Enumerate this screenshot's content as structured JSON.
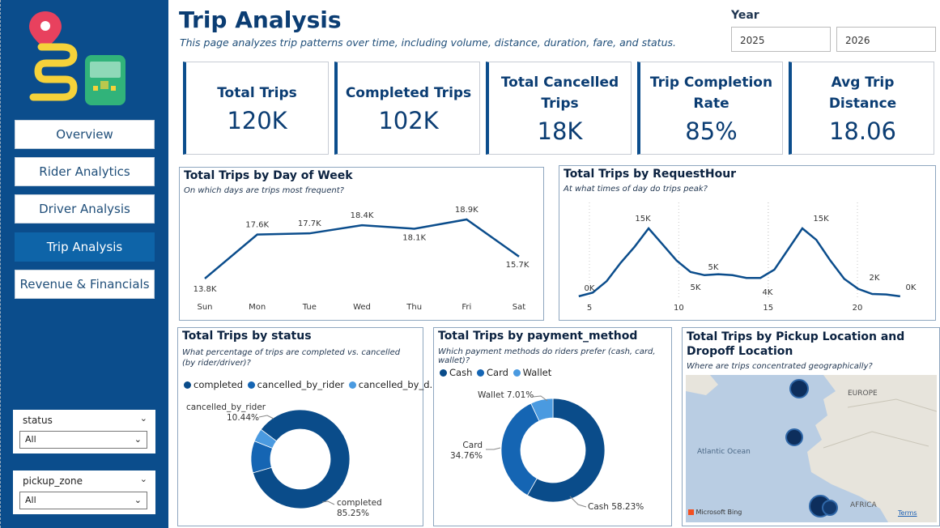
{
  "nav": {
    "items": [
      "Overview",
      "Rider Analytics",
      "Driver Analysis",
      "Trip Analysis",
      "Revenue & Financials"
    ],
    "active_index": 3
  },
  "filters": {
    "status": {
      "label": "status",
      "value": "All"
    },
    "pickup_zone": {
      "label": "pickup_zone",
      "value": "All"
    }
  },
  "header": {
    "title": "Trip Analysis",
    "subtitle": "This page analyzes trip patterns over time, including volume, distance, duration, fare, and status.",
    "year_label": "Year",
    "years": [
      "2025",
      "2026"
    ]
  },
  "kpis": [
    {
      "title": "Total Trips",
      "value": "120K"
    },
    {
      "title": "Completed Trips",
      "value": "102K"
    },
    {
      "title": "Total Cancelled Trips",
      "value": "18K"
    },
    {
      "title": "Trip Completion Rate",
      "value": "85%"
    },
    {
      "title": "Avg Trip Distance",
      "value": "18.06"
    }
  ],
  "colors": {
    "brand": "#0b4d8c",
    "line": "#0b4d8c",
    "completed": "#0a4c8a",
    "cancelled_by_rider": "#1565b3",
    "cancelled_by_driver": "#4a9ae0",
    "cash": "#0a4c8a",
    "card": "#1565b3",
    "wallet": "#4a9ae0"
  },
  "day_chart": {
    "title": "Total Trips by Day of Week",
    "subtitle": "On which days are trips most frequent?"
  },
  "hour_chart": {
    "title": "Total Trips by RequestHour",
    "subtitle": "At what times of day do trips peak?"
  },
  "status_chart": {
    "title": "Total Trips by status",
    "subtitle": "What percentage of trips are completed vs. cancelled (by rider/driver)?",
    "legend": [
      "completed",
      "cancelled_by_rider",
      "cancelled_by_d..."
    ],
    "label_rider_name": "cancelled_by_rider",
    "label_rider_pct": "10.44%",
    "label_completed_name": "completed",
    "label_completed_pct": "85.25%"
  },
  "payment_chart": {
    "title": "Total Trips by payment_method",
    "subtitle": "Which payment methods do riders prefer (cash, card, wallet)?",
    "legend": [
      "Cash",
      "Card",
      "Wallet"
    ],
    "label_wallet": "Wallet 7.01%",
    "label_card_name": "Card",
    "label_card_pct": "34.76%",
    "label_cash": "Cash 58.23%"
  },
  "map": {
    "title": "Total Trips by Pickup Location and Dropoff Location",
    "subtitle": "Where are trips concentrated geographically?",
    "label_europe": "EUROPE",
    "label_ocean": "Atlantic Ocean",
    "label_africa": "AFRICA",
    "bing": "Microsoft Bing",
    "terms": "Terms"
  },
  "chart_data": [
    {
      "type": "line",
      "title": "Total Trips by Day of Week",
      "categories": [
        "Sun",
        "Mon",
        "Tue",
        "Wed",
        "Thu",
        "Fri",
        "Sat"
      ],
      "values": [
        13.8,
        17.6,
        17.7,
        18.4,
        18.1,
        18.9,
        15.7
      ],
      "data_labels": [
        "13.8K",
        "17.6K",
        "17.7K",
        "18.4K",
        "18.1K",
        "18.9K",
        "15.7K"
      ],
      "unit": "K"
    },
    {
      "type": "line",
      "title": "Total Trips by RequestHour",
      "x": [
        0,
        1,
        2,
        3,
        4,
        5,
        6,
        7,
        8,
        9,
        10,
        11,
        12,
        13,
        14,
        15,
        16,
        17,
        18,
        19,
        20,
        21,
        22,
        23
      ],
      "values": [
        0.2,
        1,
        3.5,
        7.5,
        11,
        15,
        11.5,
        8,
        5.5,
        4.8,
        5,
        4.8,
        4.2,
        4.2,
        6,
        10.5,
        15,
        12.5,
        8,
        4,
        1.8,
        0.7,
        0.6,
        0.2
      ],
      "x_ticks": [
        5,
        10,
        15,
        20
      ],
      "data_labels": [
        {
          "x": 0,
          "text": "0K"
        },
        {
          "x": 3,
          "text": "15K"
        },
        {
          "x": 5,
          "text": "5K"
        },
        {
          "x": 6,
          "text": "5K"
        },
        {
          "x": 10,
          "text": "4K"
        },
        {
          "x": 13,
          "text": "15K"
        },
        {
          "x": 16,
          "text": "2K"
        },
        {
          "x": 18,
          "text": "0K"
        }
      ],
      "unit": "K"
    },
    {
      "type": "pie",
      "title": "Total Trips by status",
      "labels": [
        "completed",
        "cancelled_by_rider",
        "cancelled_by_driver"
      ],
      "values": [
        85.25,
        10.44,
        4.31
      ]
    },
    {
      "type": "pie",
      "title": "Total Trips by payment_method",
      "labels": [
        "Cash",
        "Card",
        "Wallet"
      ],
      "values": [
        58.23,
        34.76,
        7.01
      ]
    }
  ]
}
